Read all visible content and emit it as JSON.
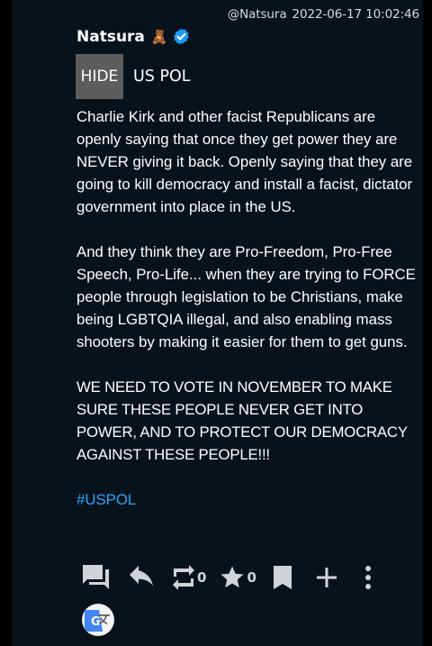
{
  "post": {
    "handle": "@Natsura",
    "timestamp": "2022-06-17 10:02:46",
    "author_name": "Natsura",
    "author_emoji": "🧸",
    "verified_icon": "verified-badge-icon",
    "content_warning": {
      "toggle_label": "HIDE",
      "summary": "US POL"
    },
    "paragraphs": [
      "Charlie Kirk and other facist Republicans are openly saying that once they get power they are NEVER giving it back. Openly saying that they are going to kill democracy and install a facist, dictator government into place in the US.",
      "And they think they are Pro-Freedom, Pro-Free Speech, Pro-Life... when they are trying to FORCE people through legislation to be Christians, make being LGBTQIA illegal, and also enabling mass shooters by making it easier for them to get guns.",
      "WE NEED TO VOTE IN NOVEMBER TO MAKE SURE THESE PEOPLE NEVER GET INTO POWER, AND TO PROTECT OUR DEMOCRACY AGAINST THESE PEOPLE!!!"
    ],
    "hashtag": "#USPOL"
  },
  "actions": {
    "reply_icon": "reply-all-icon",
    "reply2_icon": "reply-arrow-icon",
    "boost_icon": "repeat-icon",
    "boost_count": "0",
    "favourite_icon": "star-icon",
    "favourite_count": "0",
    "bookmark_icon": "bookmark-icon",
    "add_icon": "plus-icon",
    "more_icon": "more-vertical-icon",
    "translate_icon": "google-translate-icon"
  },
  "colors": {
    "background": "#08121b",
    "hashtag": "#2aa5ff",
    "hide_button": "#5d5d5d",
    "verified": "#1d9bf0"
  }
}
